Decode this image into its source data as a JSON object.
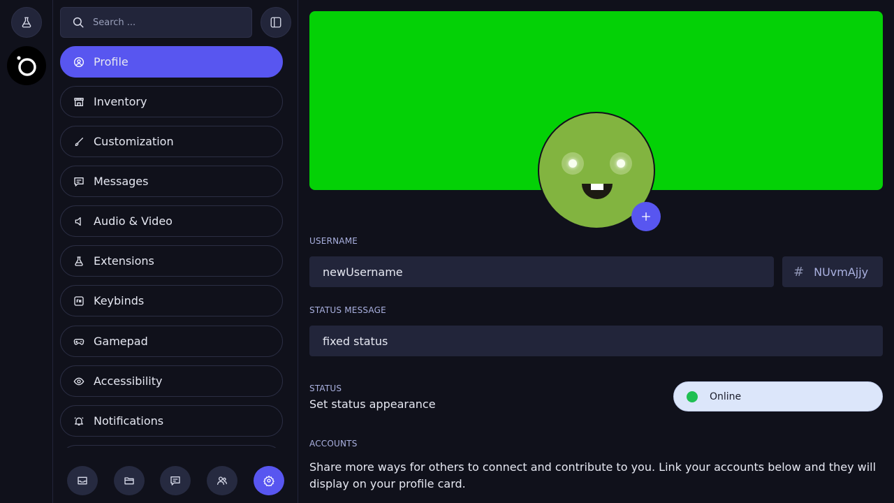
{
  "search": {
    "placeholder": "Search ..."
  },
  "sidebar": {
    "items": [
      {
        "label": "Profile",
        "icon": "user-circle-icon",
        "active": true
      },
      {
        "label": "Inventory",
        "icon": "store-icon"
      },
      {
        "label": "Customization",
        "icon": "brush-icon"
      },
      {
        "label": "Messages",
        "icon": "message-icon"
      },
      {
        "label": "Audio & Video",
        "icon": "speaker-icon"
      },
      {
        "label": "Extensions",
        "icon": "flask-icon"
      },
      {
        "label": "Keybinds",
        "icon": "keyboard-key-icon"
      },
      {
        "label": "Gamepad",
        "icon": "gamepad-icon"
      },
      {
        "label": "Accessibility",
        "icon": "eye-icon"
      },
      {
        "label": "Notifications",
        "icon": "bell-icon"
      }
    ]
  },
  "bottom_bar": [
    "inbox-icon",
    "folder-icon",
    "chat-icon",
    "friends-icon",
    "settings-icon"
  ],
  "profile": {
    "banner_color": "#04d106",
    "username_label": "USERNAME",
    "username_value": "newUsername",
    "discriminator_value": "NUvmAjjy",
    "status_message_label": "STATUS MESSAGE",
    "status_message_value": "fixed status",
    "status_label": "STATUS",
    "status_description": "Set status appearance",
    "status_value": "Online",
    "status_color": "#1fbf52",
    "accounts_label": "ACCOUNTS",
    "accounts_description": "Share more ways for others to connect and contribute to you. Link your accounts below and they will display on your profile card."
  }
}
